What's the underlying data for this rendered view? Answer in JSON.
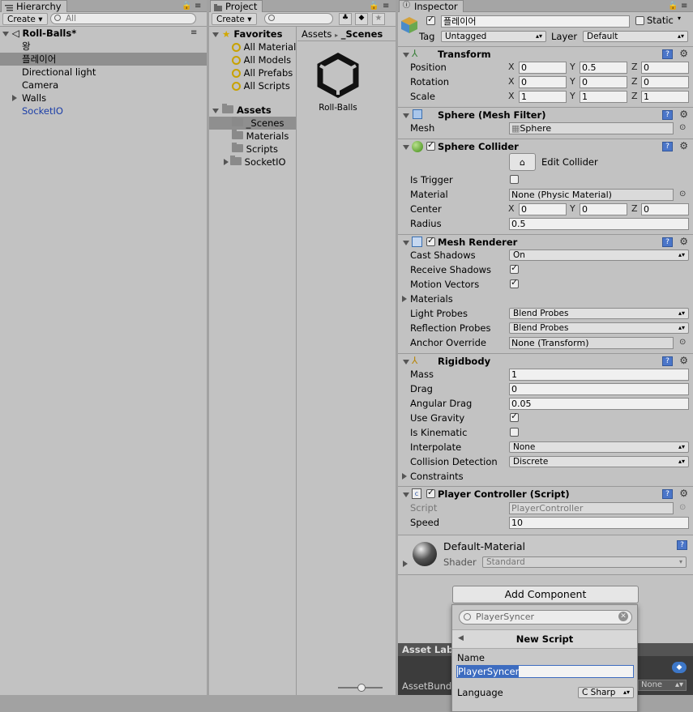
{
  "colors": {
    "panel_bg": "#c2c2c2",
    "selection_gray": "#8f8f8f",
    "selection_blue": "#3d6cc0",
    "link_blue": "#1c3fa8",
    "dark_bar": "#333333"
  },
  "hierarchy": {
    "tab_label": "Hierarchy",
    "create_label": "Create",
    "search_placeholder": "All",
    "scene_name": "Roll-Balls*",
    "items": [
      {
        "label": "왕"
      },
      {
        "label": "플레이어"
      },
      {
        "label": "Directional light"
      },
      {
        "label": "Camera"
      },
      {
        "label": "Walls"
      },
      {
        "label": "SocketIO"
      }
    ]
  },
  "project": {
    "tab_label": "Project",
    "create_label": "Create",
    "favorites_label": "Favorites",
    "favorites": [
      "All Material",
      "All Models",
      "All Prefabs",
      "All Scripts"
    ],
    "assets_label": "Assets",
    "asset_folders": [
      "_Scenes",
      "Materials",
      "Scripts",
      "SocketIO"
    ],
    "breadcrumb": [
      "Assets",
      "_Scenes"
    ],
    "asset_item_label": "Roll-Balls"
  },
  "inspector": {
    "tab_label": "Inspector",
    "object_name": "플레이어",
    "static_label": "Static",
    "tag_label": "Tag",
    "tag_value": "Untagged",
    "layer_label": "Layer",
    "layer_value": "Default",
    "transform": {
      "title": "Transform",
      "position_label": "Position",
      "rotation_label": "Rotation",
      "scale_label": "Scale",
      "position": [
        "0",
        "0.5",
        "0"
      ],
      "rotation": [
        "0",
        "0",
        "0"
      ],
      "scale": [
        "1",
        "1",
        "1"
      ]
    },
    "mesh_filter": {
      "title": "Sphere (Mesh Filter)",
      "mesh_label": "Mesh",
      "mesh_value": "Sphere"
    },
    "sphere_collider": {
      "title": "Sphere Collider",
      "edit_label": "Edit Collider",
      "is_trigger_label": "Is Trigger",
      "material_label": "Material",
      "material_value": "None (Physic Material)",
      "center_label": "Center",
      "center": [
        "0",
        "0",
        "0"
      ],
      "radius_label": "Radius",
      "radius_value": "0.5"
    },
    "mesh_renderer": {
      "title": "Mesh Renderer",
      "cast_shadows_label": "Cast Shadows",
      "cast_shadows_value": "On",
      "receive_shadows_label": "Receive Shadows",
      "motion_vectors_label": "Motion Vectors",
      "materials_label": "Materials",
      "light_probes_label": "Light Probes",
      "light_probes_value": "Blend Probes",
      "reflection_probes_label": "Reflection Probes",
      "reflection_probes_value": "Blend Probes",
      "anchor_override_label": "Anchor Override",
      "anchor_override_value": "None (Transform)"
    },
    "rigidbody": {
      "title": "Rigidbody",
      "mass_label": "Mass",
      "mass_value": "1",
      "drag_label": "Drag",
      "drag_value": "0",
      "angular_drag_label": "Angular Drag",
      "angular_drag_value": "0.05",
      "use_gravity_label": "Use Gravity",
      "is_kinematic_label": "Is Kinematic",
      "interpolate_label": "Interpolate",
      "interpolate_value": "None",
      "collision_detection_label": "Collision Detection",
      "collision_detection_value": "Discrete",
      "constraints_label": "Constraints"
    },
    "player_controller": {
      "title": "Player Controller (Script)",
      "script_label": "Script",
      "script_value": "PlayerController",
      "speed_label": "Speed",
      "speed_value": "10"
    },
    "material": {
      "name": "Default-Material",
      "shader_label": "Shader",
      "shader_value": "Standard"
    },
    "add_component_label": "Add Component",
    "asset_labels_label": "Asset Lab",
    "asset_bundle_label": "AssetBund",
    "asset_bundle_value": "None"
  },
  "add_component_popup": {
    "search_value": "PlayerSyncer",
    "header": "New Script",
    "name_label": "Name",
    "name_value": "PlayerSyncer",
    "language_label": "Language",
    "language_value": "C Sharp"
  },
  "axes": {
    "x": "X",
    "y": "Y",
    "z": "Z"
  }
}
